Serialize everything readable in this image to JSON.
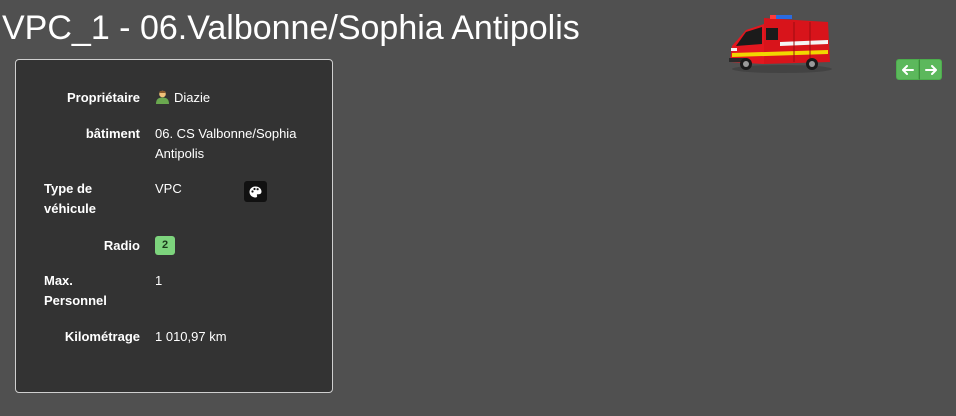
{
  "header": {
    "title": "VPC_1 - 06.Valbonne/Sophia Antipolis"
  },
  "vehicle_image": {
    "icon": "fire-truck-icon"
  },
  "navigation": {
    "previous_icon": "arrow-left-icon",
    "next_icon": "arrow-right-icon",
    "color": "#5cb85c"
  },
  "details": {
    "owner": {
      "label": "Propriétaire",
      "value": "Diazie",
      "icon": "user-icon"
    },
    "building": {
      "label": "bâtiment",
      "value_line1": "06. CS Valbonne/Sophia",
      "value_line2": "Antipolis"
    },
    "vehicle_type": {
      "label_line1": "Type de",
      "label_line2": "véhicule",
      "value": "VPC",
      "action_icon": "palette-icon"
    },
    "radio": {
      "label": "Radio",
      "value": "2",
      "badge_color": "#7dd47d"
    },
    "max_personnel": {
      "label_line1": "Max.",
      "label_line2": "Personnel",
      "value": "1"
    },
    "mileage": {
      "label": "Kilométrage",
      "value": "1 010,97 km"
    }
  }
}
